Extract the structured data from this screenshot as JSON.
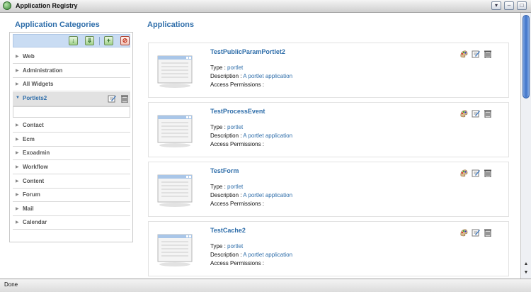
{
  "window": {
    "title": "Application Registry",
    "controls": [
      "▾",
      "–",
      "□"
    ]
  },
  "left": {
    "title": "Application Categories",
    "categories": [
      "Web",
      "Administration",
      "All Widgets",
      "Portlets2",
      "Contact",
      "Ecm",
      "Exoadmin",
      "Workflow",
      "Content",
      "Forum",
      "Mail",
      "Calendar"
    ],
    "selected": "Portlets2"
  },
  "right": {
    "title": "Applications",
    "labels": {
      "type": "Type :",
      "description": "Description :",
      "access": "Access Permissions :"
    },
    "apps": [
      {
        "name": "TestPublicParamPortlet2",
        "type": "portlet",
        "description": "A portlet application",
        "access": ""
      },
      {
        "name": "TestProcessEvent",
        "type": "portlet",
        "description": "A portlet application",
        "access": ""
      },
      {
        "name": "TestForm",
        "type": "portlet",
        "description": "A portlet application",
        "access": ""
      },
      {
        "name": "TestCache2",
        "type": "portlet",
        "description": "A portlet application",
        "access": ""
      }
    ]
  },
  "status": {
    "text": "Done"
  },
  "colors": {
    "accent": "#2f6eaa",
    "toolbar": "#c9dcf3",
    "selected_row": "#e2e2e2"
  }
}
